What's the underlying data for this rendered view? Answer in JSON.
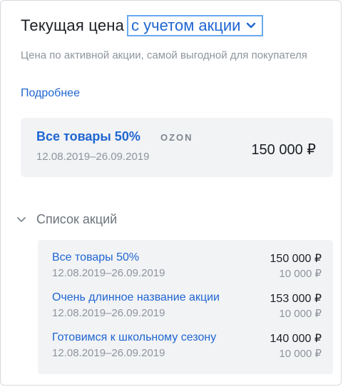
{
  "header": {
    "title": "Текущая цена",
    "mode_selected": "с учетом акции"
  },
  "subtitle": "Цена по активной акции, самой выгодной для покупателя",
  "more_link": "Подробнее",
  "active_promo": {
    "name": "Все товары 50%",
    "brand": "OZON",
    "dates": "12.08.2019–26.09.2019",
    "price": "150 000 ₽"
  },
  "promo_list": {
    "label": "Список акций",
    "items": [
      {
        "name": "Все товары 50%",
        "dates": "12.08.2019–26.09.2019",
        "price": "150 000 ₽",
        "limit": "10 000 ₽"
      },
      {
        "name": "Очень длинное название акции",
        "dates": "12.08.2019–26.09.2019",
        "price": "153 000 ₽",
        "limit": "10 000 ₽"
      },
      {
        "name": "Готовимся к школьному сезону",
        "dates": "12.08.2019–26.09.2019",
        "price": "140 000 ₽",
        "limit": "10 000 ₽"
      }
    ]
  },
  "colors": {
    "accent": "#1f66d1",
    "focus_border": "#6aa9ef",
    "card_bg": "#f2f3f5",
    "muted_text": "#8e959d"
  }
}
